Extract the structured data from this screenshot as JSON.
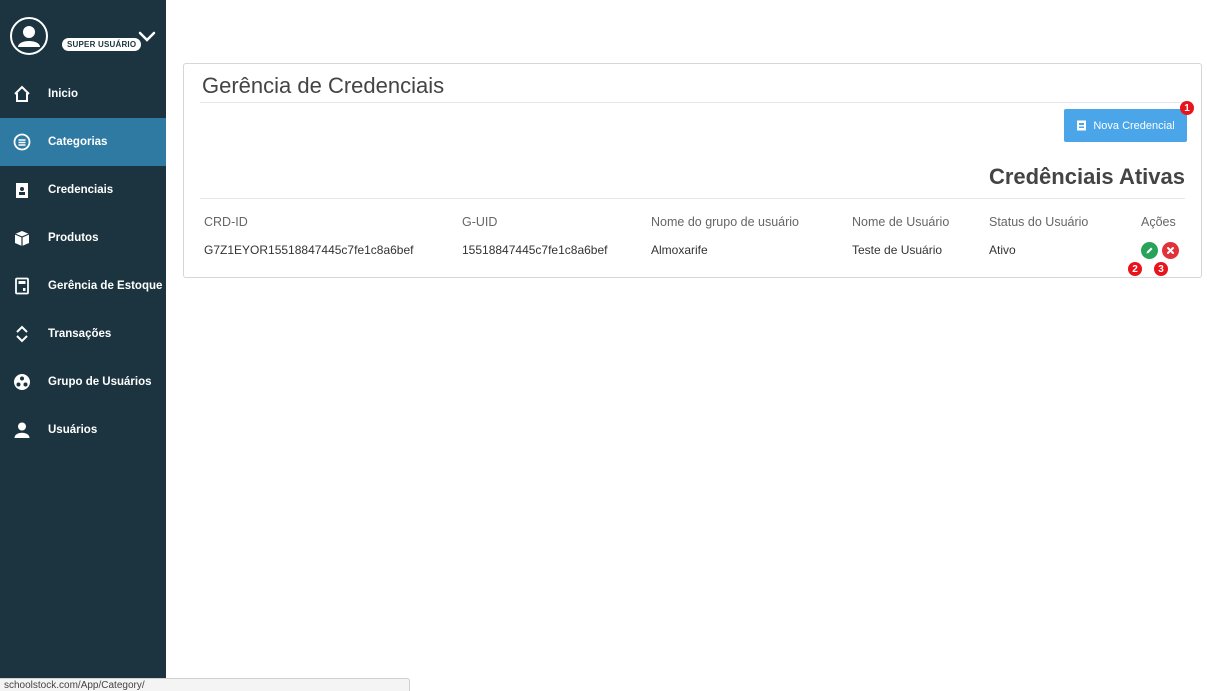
{
  "sidebar": {
    "role_badge": "SUPER USUÁRIO",
    "items": [
      {
        "label": "Inicio",
        "icon": "home-icon",
        "active": false
      },
      {
        "label": "Categorias",
        "icon": "list-circle-icon",
        "active": true
      },
      {
        "label": "Credenciais",
        "icon": "badge-icon",
        "active": false
      },
      {
        "label": "Produtos",
        "icon": "box-icon",
        "active": false
      },
      {
        "label": "Gerência de Estoque",
        "icon": "calculator-icon",
        "active": false
      },
      {
        "label": "Transações",
        "icon": "swap-icon",
        "active": false
      },
      {
        "label": "Grupo de Usuários",
        "icon": "group-icon",
        "active": false
      },
      {
        "label": "Usuários",
        "icon": "user-icon",
        "active": false
      }
    ]
  },
  "main": {
    "title": "Gerência de Credenciais",
    "new_button_label": "Nova Credencial",
    "section_title": "Credênciais Ativas",
    "markers": [
      "1",
      "2",
      "3"
    ],
    "table": {
      "headers": [
        "CRD-ID",
        "G-UID",
        "Nome do grupo de usuário",
        "Nome de Usuário",
        "Status do Usuário",
        "Ações"
      ],
      "rows": [
        {
          "crd_id": "G7Z1EYOR15518847445c7fe1c8a6bef",
          "g_uid": "15518847445c7fe1c8a6bef",
          "group": "Almoxarife",
          "user": "Teste de Usuário",
          "status": "Ativo"
        }
      ]
    }
  },
  "status_bar": {
    "url": "schoolstock.com/App/Category/"
  },
  "colors": {
    "sidebar_bg": "#1b3440",
    "sidebar_active": "#2e7aa3",
    "primary_button": "#4aa6e8",
    "edit_green": "#27a35a",
    "delete_red": "#e1323c",
    "marker_red": "#e8131b"
  }
}
